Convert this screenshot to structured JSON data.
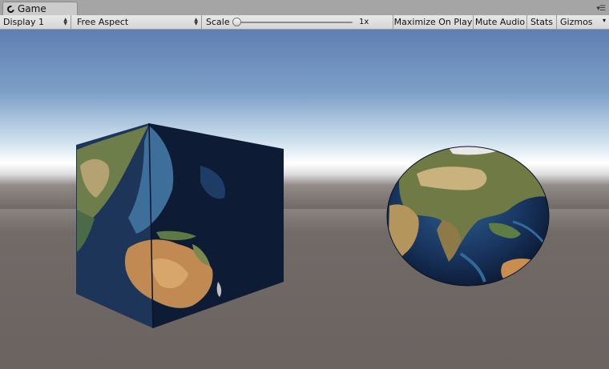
{
  "tab": {
    "label": "Game"
  },
  "toolbar": {
    "display": "Display 1",
    "aspect": "Free Aspect",
    "scale_label": "Scale",
    "scale_value": "1x",
    "scale_level": 0,
    "maximize": "Maximize On Play",
    "mute": "Mute Audio",
    "stats": "Stats",
    "gizmos": "Gizmos"
  },
  "scene": {
    "objects": [
      "earth-textured-cube",
      "earth-textured-sphere"
    ],
    "sky_color": "#6a87b6",
    "horizon_color": "#ffffff",
    "ground_color": "#6e6764"
  }
}
